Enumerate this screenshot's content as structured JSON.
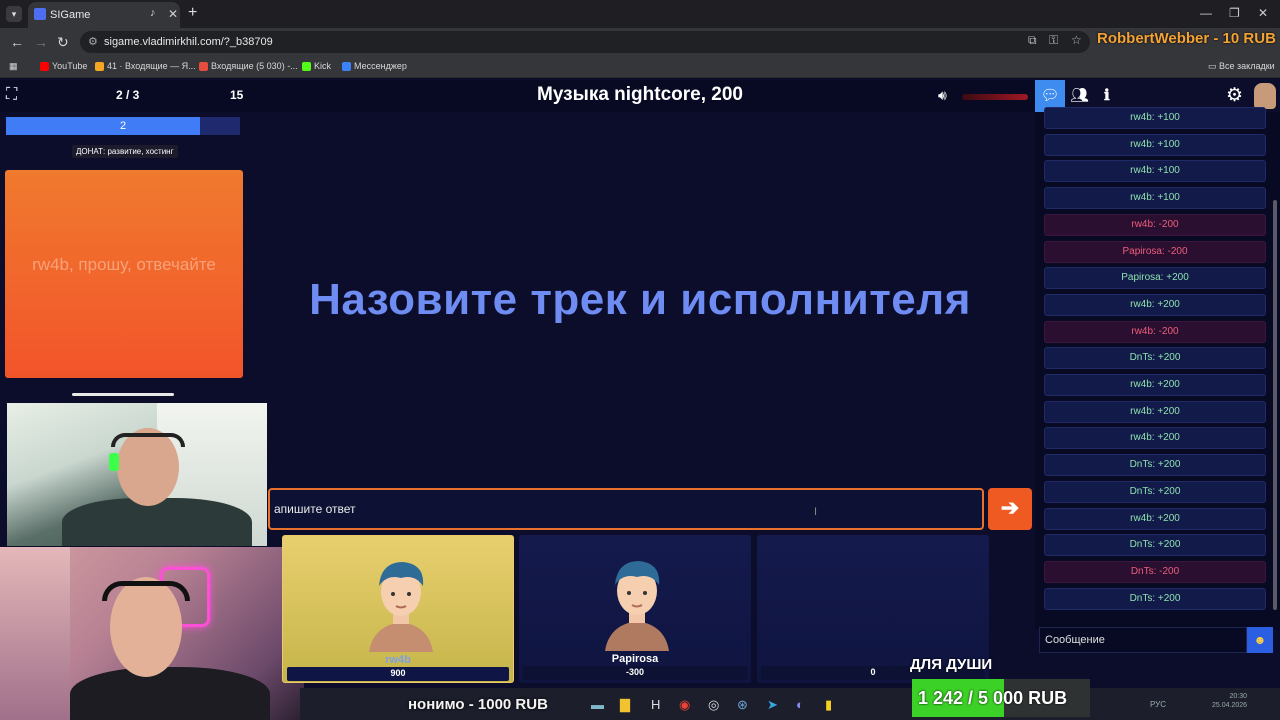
{
  "browser": {
    "tab_title": "SIGame",
    "url": "sigame.vladimirkhil.com/?_b38709",
    "new_tab": "+",
    "bookmarks": [
      {
        "label": "YouTube",
        "color": "#ff0000"
      },
      {
        "label": "41 · Входящие — Я...",
        "color": "#f5a623"
      },
      {
        "label": "Входящие (5 030) -...",
        "color": "#e74c3c"
      },
      {
        "label": "Kick",
        "color": "#53fc18"
      },
      {
        "label": "Мессенджер",
        "color": "#3b82f6"
      }
    ],
    "all_bookmarks": "Все закладки"
  },
  "overlay": {
    "top_donation": "RobbertWebber - 10 RUB",
    "donor_line": "нонимо - 1000 RUB",
    "goal_label": "ДЛЯ ДУШИ",
    "goal_text": "1 242 / 5 000 RUB",
    "goal_progress": 0.2484,
    "tray_lang": "РУС",
    "tray_time": "20:30",
    "tray_date": "25.04.2026"
  },
  "game": {
    "round_counter": "2 / 3",
    "timer_value": "15",
    "question_title": "Музыка nightcore, 200",
    "progress_label": "2",
    "progress_fraction": 0.83,
    "donate_tooltip": "ДОНАТ: развитие, хостинг",
    "host_message": "rw4b, прошу, отвечайте",
    "main_question": "Назовите трек и исполнителя",
    "answer_placeholder": "апишите ответ",
    "send_arrow": "➔",
    "players": [
      {
        "name": "rw4b",
        "score": "900",
        "active": true
      },
      {
        "name": "Papirosa",
        "score": "-300",
        "active": false
      },
      {
        "name": "",
        "score": "0",
        "active": false
      }
    ]
  },
  "chat": {
    "messages": [
      {
        "text": "rw4b: +100",
        "kind": "pos"
      },
      {
        "text": "rw4b: +100",
        "kind": "pos"
      },
      {
        "text": "rw4b: +100",
        "kind": "pos"
      },
      {
        "text": "rw4b: +100",
        "kind": "pos"
      },
      {
        "text": "rw4b: -200",
        "kind": "neg"
      },
      {
        "text": "Papirosa: -200",
        "kind": "neg"
      },
      {
        "text": "Papirosa: +200",
        "kind": "pos"
      },
      {
        "text": "rw4b: +200",
        "kind": "pos"
      },
      {
        "text": "rw4b: -200",
        "kind": "neg"
      },
      {
        "text": "DnTs: +200",
        "kind": "pos"
      },
      {
        "text": "rw4b: +200",
        "kind": "pos"
      },
      {
        "text": "rw4b: +200",
        "kind": "pos"
      },
      {
        "text": "rw4b: +200",
        "kind": "pos"
      },
      {
        "text": "DnTs: +200",
        "kind": "pos"
      },
      {
        "text": "DnTs: +200",
        "kind": "pos"
      },
      {
        "text": "rw4b: +200",
        "kind": "pos"
      },
      {
        "text": "DnTs: +200",
        "kind": "pos"
      },
      {
        "text": "DnTs: -200",
        "kind": "neg"
      },
      {
        "text": "DnTs: +200",
        "kind": "pos"
      }
    ],
    "message_placeholder": "Сообщение"
  },
  "icons": {
    "logo": "logo-icon",
    "volume": "volume-icon",
    "chat": "chat-icon",
    "players": "players-icon",
    "info": "info-icon",
    "settings": "gear-icon",
    "emoji": "emoji-icon"
  },
  "colors": {
    "accent_orange": "#ef5a22",
    "question_blue": "#6f8cf3",
    "chat_tab": "#3f8cf0",
    "positive": "#8fe0b0",
    "negative": "#ef5d7d",
    "goal_green": "#3bd126"
  }
}
